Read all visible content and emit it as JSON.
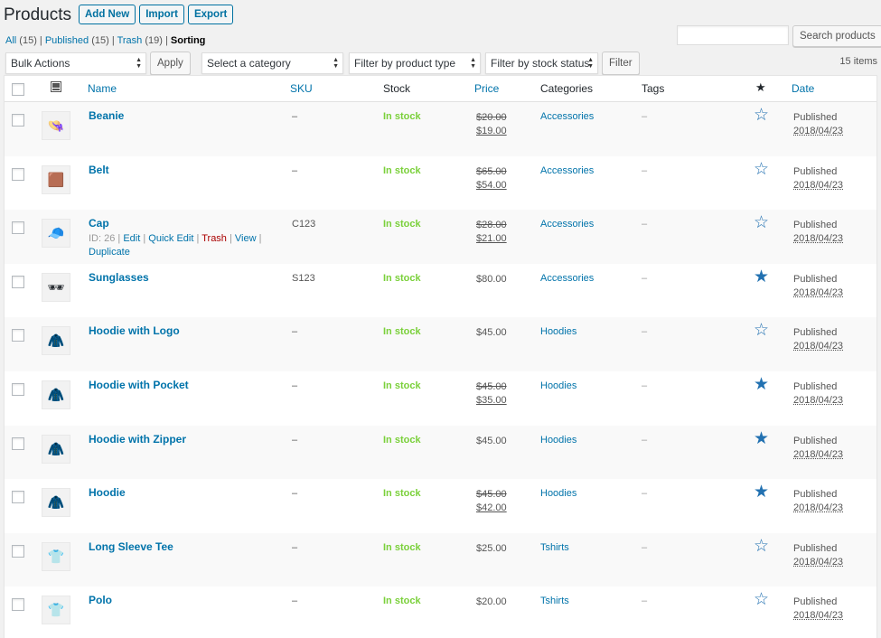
{
  "header": {
    "title": "Products",
    "add_new": "Add New",
    "import": "Import",
    "export": "Export"
  },
  "views": [
    {
      "label": "All",
      "count": "(15)"
    },
    {
      "label": "Published",
      "count": "(15)"
    },
    {
      "label": "Trash",
      "count": "(19)"
    },
    {
      "label": "Sorting"
    }
  ],
  "search": {
    "placeholder": "",
    "button": "Search products"
  },
  "tablenav": {
    "bulk_actions": "Bulk Actions",
    "apply": "Apply",
    "category": "Select a category",
    "product_type": "Filter by product type",
    "stock_status": "Filter by stock status",
    "filter": "Filter",
    "items": "15 items"
  },
  "columns": {
    "thumb_icon": "image-icon",
    "name": "Name",
    "sku": "SKU",
    "stock": "Stock",
    "price": "Price",
    "categories": "Categories",
    "tags": "Tags",
    "featured_icon": "star-icon",
    "date": "Date"
  },
  "rows": [
    {
      "name": "Beanie",
      "sku": "–",
      "stock": "In stock",
      "regular_price": "$20.00",
      "sale_price": "$19.00",
      "category": "Accessories",
      "tags": "–",
      "featured": false,
      "status": "Published",
      "date": "2018/04/23",
      "icon": "👒"
    },
    {
      "name": "Belt",
      "sku": "–",
      "stock": "In stock",
      "regular_price": "$65.00",
      "sale_price": "$54.00",
      "category": "Accessories",
      "tags": "–",
      "featured": false,
      "status": "Published",
      "date": "2018/04/23",
      "icon": "🟫"
    },
    {
      "name": "Cap",
      "sku": "C123",
      "stock": "In stock",
      "regular_price": "$28.00",
      "sale_price": "$21.00",
      "category": "Accessories",
      "tags": "–",
      "featured": false,
      "status": "Published",
      "date": "2018/04/23",
      "icon": "🧢",
      "row_actions": {
        "id": "ID: 26",
        "edit": "Edit",
        "quick_edit": "Quick Edit",
        "trash": "Trash",
        "view": "View",
        "duplicate": "Duplicate"
      }
    },
    {
      "name": "Sunglasses",
      "sku": "S123",
      "stock": "In stock",
      "price": "$80.00",
      "category": "Accessories",
      "tags": "–",
      "featured": true,
      "status": "Published",
      "date": "2018/04/23",
      "icon": "🕶"
    },
    {
      "name": "Hoodie with Logo",
      "sku": "–",
      "stock": "In stock",
      "price": "$45.00",
      "category": "Hoodies",
      "tags": "–",
      "featured": false,
      "status": "Published",
      "date": "2018/04/23",
      "icon": "🧥"
    },
    {
      "name": "Hoodie with Pocket",
      "sku": "–",
      "stock": "In stock",
      "regular_price": "$45.00",
      "sale_price": "$35.00",
      "category": "Hoodies",
      "tags": "–",
      "featured": true,
      "status": "Published",
      "date": "2018/04/23",
      "icon": "🧥"
    },
    {
      "name": "Hoodie with Zipper",
      "sku": "–",
      "stock": "In stock",
      "price": "$45.00",
      "category": "Hoodies",
      "tags": "–",
      "featured": true,
      "status": "Published",
      "date": "2018/04/23",
      "icon": "🧥"
    },
    {
      "name": "Hoodie",
      "sku": "–",
      "stock": "In stock",
      "regular_price": "$45.00",
      "sale_price": "$42.00",
      "category": "Hoodies",
      "tags": "–",
      "featured": true,
      "status": "Published",
      "date": "2018/04/23",
      "icon": "🧥"
    },
    {
      "name": "Long Sleeve Tee",
      "sku": "–",
      "stock": "In stock",
      "price": "$25.00",
      "category": "Tshirts",
      "tags": "–",
      "featured": false,
      "status": "Published",
      "date": "2018/04/23",
      "icon": "👕"
    },
    {
      "name": "Polo",
      "sku": "–",
      "stock": "In stock",
      "price": "$20.00",
      "category": "Tshirts",
      "tags": "–",
      "featured": false,
      "status": "Published",
      "date": "2018/04/23",
      "icon": "👕"
    }
  ],
  "colors": {
    "link": "#0073aa",
    "in_stock": "#7ad03a",
    "trash": "#aa0000",
    "star": "#2271b1"
  }
}
